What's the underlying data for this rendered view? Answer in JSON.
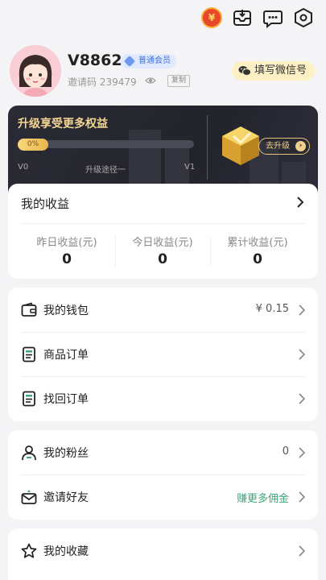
{
  "profile": {
    "username": "V8862",
    "member_badge": "普通会员",
    "invite_label": "邀请码",
    "invite_code": "239479",
    "copy_label": "复制",
    "wechat_button": "填写微信号"
  },
  "upgrade": {
    "title": "升级享受更多权益",
    "progress_text": "0%",
    "progress": 0,
    "level_from": "V0",
    "path_label": "升级途径一",
    "level_to": "V1",
    "button": "去升级"
  },
  "earnings": {
    "title": "我的收益",
    "stats": [
      {
        "label": "昨日收益(元)",
        "value": "0"
      },
      {
        "label": "今日收益(元)",
        "value": "0"
      },
      {
        "label": "累计收益(元)",
        "value": "0"
      }
    ]
  },
  "menu1": [
    {
      "label": "我的钱包",
      "value": "¥ 0.15",
      "icon": "wallet-icon"
    },
    {
      "label": "商品订单",
      "value": "",
      "icon": "order-icon"
    },
    {
      "label": "找回订单",
      "value": "",
      "icon": "recover-order-icon"
    }
  ],
  "menu2": [
    {
      "label": "我的粉丝",
      "value": "0",
      "icon": "user-icon"
    },
    {
      "label": "邀请好友",
      "value": "赚更多佣金",
      "icon": "invite-icon"
    }
  ],
  "menu3": [
    {
      "label": "我的收藏",
      "value": "",
      "icon": "star-icon"
    }
  ],
  "colors": {
    "accent_gold": "#f3d693",
    "green": "#3ca67a",
    "wechat_bg": "#fdf0c4"
  }
}
